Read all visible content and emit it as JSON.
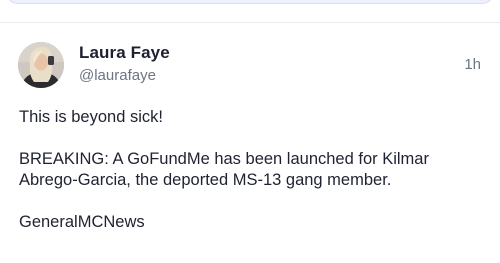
{
  "post": {
    "author": {
      "display_name": "Laura Faye",
      "handle": "@laurafaye",
      "avatar_icon": "user-avatar"
    },
    "timestamp": "1h",
    "paragraphs": [
      "This is beyond sick!",
      "BREAKING: A GoFundMe has been launched for Kilmar Abrego-Garcia, the deported MS-13 gang member.",
      "GeneralMCNews"
    ]
  },
  "colors": {
    "compose_bg": "#eef0fc",
    "text_primary": "#1f2230",
    "text_secondary": "#6d7486",
    "divider": "#e9ebf0"
  }
}
